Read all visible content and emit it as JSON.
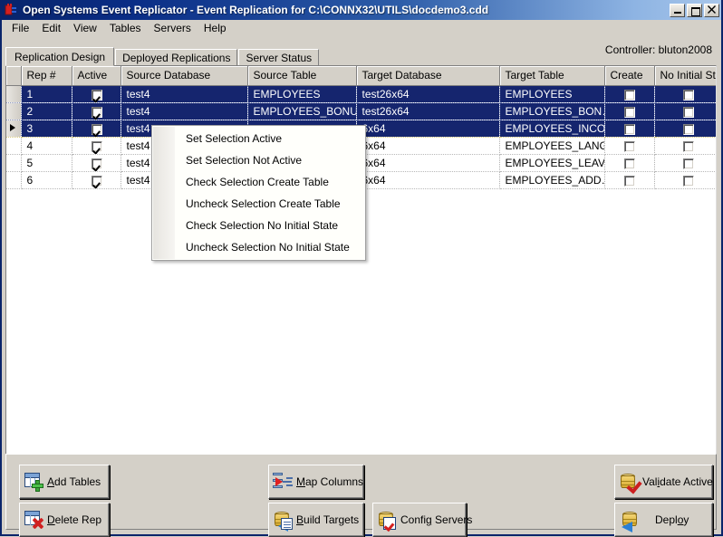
{
  "window": {
    "title": "Open Systems Event Replicator - Event Replication for C:\\CONNX32\\UTILS\\docdemo3.cdd",
    "icon": "plug-icon",
    "controls": {
      "minimize": "minimize-icon",
      "maximize": "maximize-icon",
      "close": "close-icon"
    }
  },
  "menubar": {
    "items": [
      {
        "label": "File"
      },
      {
        "label": "Edit"
      },
      {
        "label": "View"
      },
      {
        "label": "Tables"
      },
      {
        "label": "Servers"
      },
      {
        "label": "Help"
      }
    ]
  },
  "controller": {
    "label": "Controller: bluton2008"
  },
  "tabs": [
    {
      "label": "Replication Design",
      "active": true
    },
    {
      "label": "Deployed Replications",
      "active": false
    },
    {
      "label": "Server Status",
      "active": false
    }
  ],
  "grid": {
    "columns": [
      "Rep #",
      "Active",
      "Source Database",
      "Source Table",
      "Target Database",
      "Target Table",
      "Create",
      "No Initial State"
    ],
    "rows": [
      {
        "rep": "1",
        "active": true,
        "source_database": "test4",
        "source_table": "EMPLOYEES",
        "target_database": "test26x64",
        "target_table": "EMPLOYEES",
        "create": false,
        "no_initial_state": false,
        "selected": true,
        "current": false
      },
      {
        "rep": "2",
        "active": true,
        "source_database": "test4",
        "source_table": "EMPLOYEES_BONUS",
        "target_database": "test26x64",
        "target_table": "EMPLOYEES_BON…",
        "create": false,
        "no_initial_state": false,
        "selected": true,
        "current": false
      },
      {
        "rep": "3",
        "active": true,
        "source_database": "test4",
        "source_table": "",
        "target_database": "6x64",
        "target_table": "EMPLOYEES_INCO…",
        "create": false,
        "no_initial_state": false,
        "selected": true,
        "current": true
      },
      {
        "rep": "4",
        "active": true,
        "source_database": "test4",
        "source_table": "",
        "target_database": "6x64",
        "target_table": "EMPLOYEES_LANG",
        "create": false,
        "no_initial_state": false,
        "selected": false,
        "current": false
      },
      {
        "rep": "5",
        "active": true,
        "source_database": "test4",
        "source_table": "",
        "target_database": "6x64",
        "target_table": "EMPLOYEES_LEAV…",
        "create": false,
        "no_initial_state": false,
        "selected": false,
        "current": false
      },
      {
        "rep": "6",
        "active": true,
        "source_database": "test4",
        "source_table": "",
        "target_database": "6x64",
        "target_table": "EMPLOYEES_ADD…",
        "create": false,
        "no_initial_state": false,
        "selected": false,
        "current": false
      }
    ]
  },
  "context_menu": {
    "items": [
      {
        "label": "Set Selection Active"
      },
      {
        "label": "Set Selection Not Active"
      },
      {
        "label": "Check Selection Create Table"
      },
      {
        "label": "Uncheck Selection Create Table"
      },
      {
        "label": "Check Selection No Initial State"
      },
      {
        "label": "Uncheck Selection No Initial State"
      }
    ]
  },
  "buttons": {
    "add_tables": {
      "label": "Add Tables",
      "accel": "A",
      "icon": "grid-plus-icon"
    },
    "delete_rep": {
      "label": "Delete Rep",
      "accel": "D",
      "icon": "grid-x-icon"
    },
    "map_columns": {
      "label": "Map Columns",
      "accel": "M",
      "icon": "map-arrow-icon"
    },
    "build_targets": {
      "label": "Build Targets",
      "accel": "B",
      "icon": "database-doc-icon"
    },
    "config_servers": {
      "label": "Config Servers",
      "accel": "g",
      "icon": "database-check-icon"
    },
    "validate_active": {
      "label": "Validate Active",
      "accel": "i",
      "icon": "database-redcheck-icon"
    },
    "deploy": {
      "label": "Deploy",
      "accel": "o",
      "icon": "database-arrow-icon"
    }
  },
  "colors": {
    "titlebar_start": "#08246b",
    "titlebar_end": "#a8c6ea",
    "selection": "#15256e",
    "chrome": "#d4d0c8",
    "grid_bg": "#ffffff"
  }
}
